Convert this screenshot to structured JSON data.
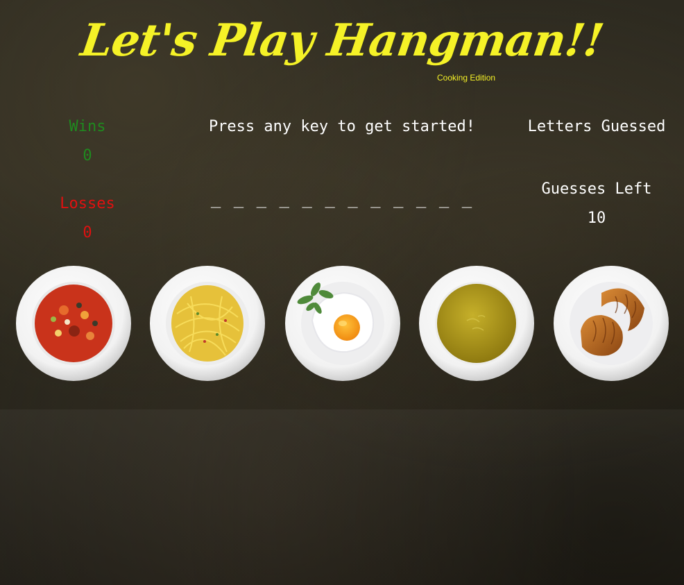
{
  "header": {
    "title": "Let's Play Hangman!!",
    "subtitle": "Cooking Edition"
  },
  "scoreboard": {
    "wins_label": "Wins",
    "wins_value": "0",
    "losses_label": "Losses",
    "losses_value": "0"
  },
  "game": {
    "prompt": "Press any key to get started!",
    "word_display": "_ _ _ _ _ _ _ _ _ _ _ _",
    "letters_guessed_label": "Letters Guessed",
    "letters_guessed": "",
    "guesses_left_label": "Guesses Left",
    "guesses_left": "10"
  },
  "plates": [
    {
      "name": "soup-bowl-icon"
    },
    {
      "name": "spaghetti-plate-icon"
    },
    {
      "name": "fried-egg-plate-icon"
    },
    {
      "name": "pea-soup-bowl-icon"
    },
    {
      "name": "croissant-plate-icon"
    }
  ],
  "colors": {
    "title": "#f5f227",
    "wins": "#1f8a1f",
    "losses": "#e01010",
    "text": "#ffffff"
  }
}
